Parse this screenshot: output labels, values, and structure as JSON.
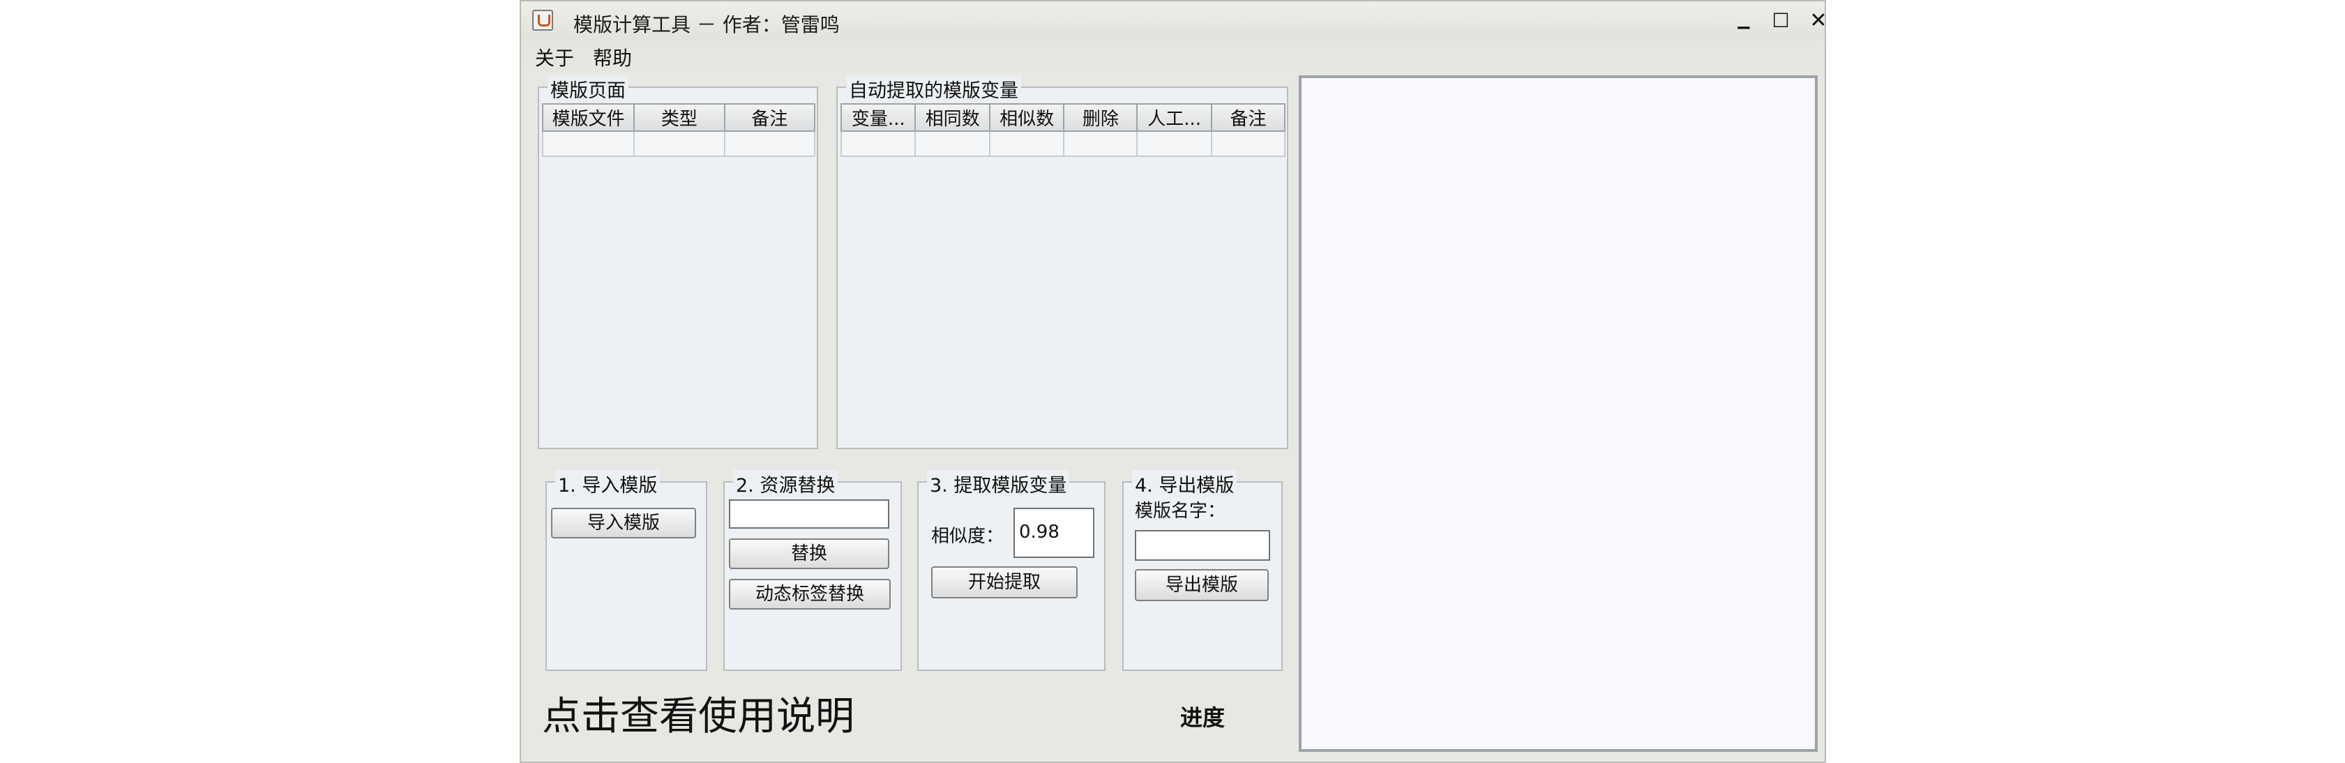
{
  "window": {
    "title": "模版计算工具 － 作者：管雷鸣",
    "minimize_glyph": "▁",
    "maximize_glyph": "☐",
    "close_glyph": "✕"
  },
  "menu": {
    "items": [
      "关于",
      "帮助"
    ]
  },
  "template_pages": {
    "title": "模版页面",
    "columns": [
      "模版文件",
      "类型",
      "备注"
    ]
  },
  "auto_vars": {
    "title": "自动提取的模版变量",
    "columns": [
      "变量...",
      "相同数",
      "相似数",
      "删除",
      "人工...",
      "备注"
    ]
  },
  "step1": {
    "title": "1. 导入模版",
    "button": "导入模版"
  },
  "step2": {
    "title": "2. 资源替换",
    "input_value": "",
    "replace_button": "替换",
    "dynamic_button": "动态标签替换"
  },
  "step3": {
    "title": "3. 提取模版变量",
    "similarity_label": "相似度：",
    "similarity_value": "0.98",
    "start_button": "开始提取"
  },
  "step4": {
    "title": "4. 导出模版",
    "name_label": "模版名字：",
    "name_value": "",
    "export_button": "导出模版"
  },
  "footer": {
    "help_link": "点击查看使用说明",
    "progress_label": "进度"
  },
  "icons": {
    "app": "java-cup-icon"
  }
}
